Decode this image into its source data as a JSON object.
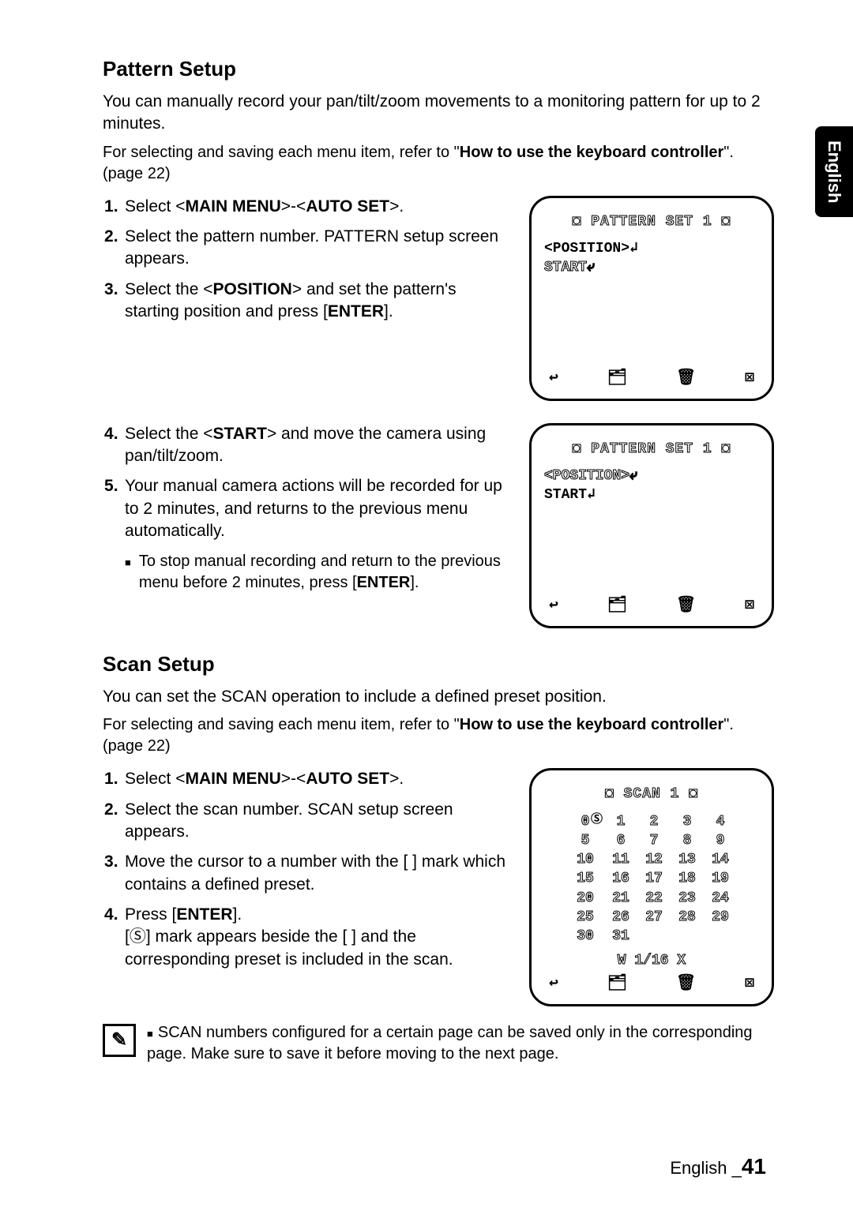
{
  "sidebar": {
    "language": "English"
  },
  "pattern": {
    "heading": "Pattern Setup",
    "intro": "You can manually record your pan/tilt/zoom movements to a monitoring pattern for up to 2 minutes.",
    "subnote_a": "For selecting and saving each menu item, refer to \"",
    "subnote_b": "How to use the keyboard controller",
    "subnote_c": "\". (page 22)",
    "step1_a": "Select <",
    "step1_b": "MAIN MENU",
    "step1_c": ">-<",
    "step1_d": "AUTO SET",
    "step1_e": ">.",
    "step2": "Select the pattern number. PATTERN setup screen appears.",
    "step3_a": "Select the <",
    "step3_b": "POSITION",
    "step3_c": "> and set the pattern's starting position and press [",
    "step3_d": "ENTER",
    "step3_e": "].",
    "step4_a": "Select the <",
    "step4_b": "START",
    "step4_c": "> and move the camera using pan/tilt/zoom.",
    "step5": "Your manual camera actions will be recorded for up to 2 minutes, and returns to the previous menu automatically.",
    "step5_note_a": "To stop manual recording and return to the previous menu before 2 minutes, press [",
    "step5_note_b": "ENTER",
    "step5_note_c": "].",
    "panel1_title": "◘  PATTERN SET 1  ◘",
    "panel1_line1": "<POSITION>↲",
    "panel1_line2": "START⤶",
    "panel2_title": "◘  PATTERN SET 1  ◘",
    "panel2_line1": "<POSITION>⤶",
    "panel2_line2": "START↲"
  },
  "scan": {
    "heading": "Scan Setup",
    "intro": "You can set the SCAN operation to include a defined preset position.",
    "subnote_a": "For selecting and saving each menu item, refer to \"",
    "subnote_b": "How to use the keyboard controller",
    "subnote_c": "\". (page 22)",
    "step1_a": "Select <",
    "step1_b": "MAIN MENU",
    "step1_c": ">-<",
    "step1_d": "AUTO SET",
    "step1_e": ">.",
    "step2": "Select the scan number. SCAN setup screen appears.",
    "step3": "Move the cursor to a number with the [   ] mark which contains a defined preset.",
    "step4_a": "Press [",
    "step4_b": "ENTER",
    "step4_c": "].",
    "step4_d": "[Ⓢ] mark appears beside the [   ] and the corresponding preset is included in the scan.",
    "panel_title": "◘  SCAN 1  ◘",
    "panel_flag": "Ⓢ",
    "panel_rows": [
      [
        "0",
        "1",
        "2",
        "3",
        "4"
      ],
      [
        "5",
        "6",
        "7",
        "8",
        "9"
      ],
      [
        "10",
        "11",
        "12",
        "13",
        "14"
      ],
      [
        "15",
        "16",
        "17",
        "18",
        "19"
      ],
      [
        "20",
        "21",
        "22",
        "23",
        "24"
      ],
      [
        "25",
        "26",
        "27",
        "28",
        "29"
      ],
      [
        "30",
        "31",
        "",
        "",
        ""
      ]
    ],
    "panel_pager": "W 1/16  X",
    "note": "SCAN numbers configured for a certain page can be saved only in the corresponding page. Make sure to save it before moving to the next page."
  },
  "icons": {
    "back": "↩",
    "save": "🗂",
    "trash": "🗑",
    "close": "⊠"
  },
  "footer": {
    "lang": "English _",
    "page": "41"
  }
}
